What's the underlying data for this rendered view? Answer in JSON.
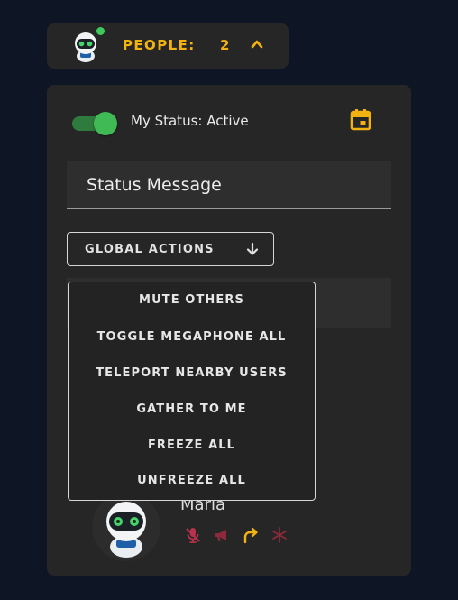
{
  "people": {
    "label": "PEOPLE:",
    "count": "2"
  },
  "status": {
    "label": "My Status: Active",
    "toggle_on": true
  },
  "status_message": {
    "placeholder": "Status Message",
    "value": ""
  },
  "global_actions": {
    "label": "GLOBAL ACTIONS",
    "items": [
      {
        "label": "MUTE OTHERS"
      },
      {
        "label": "TOGGLE MEGAPHONE ALL"
      },
      {
        "label": "TELEPORT NEARBY USERS"
      },
      {
        "label": "GATHER TO ME"
      },
      {
        "label": "FREEZE ALL"
      },
      {
        "label": "UNFREEZE ALL"
      }
    ]
  },
  "user": {
    "name": "Maria",
    "controls": [
      "mic-off-icon",
      "megaphone-icon",
      "teleport-arrow-icon",
      "freeze-icon"
    ]
  },
  "colors": {
    "background": "#0e1525",
    "panel": "#262626",
    "accent": "#f2b20f",
    "toggle_green": "#3fba54",
    "muted_red": "#b7324a"
  }
}
